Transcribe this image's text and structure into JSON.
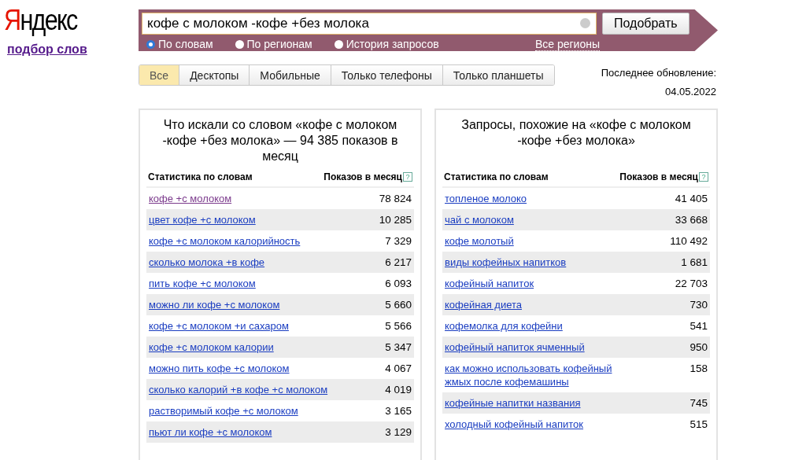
{
  "logo": {
    "text": "Яндекс",
    "subtitle": "подбор слов"
  },
  "search": {
    "value": "кофе с молоком -кофе +без молока",
    "submit": "Подобрать",
    "modes": [
      {
        "label": "По словам",
        "selected": true
      },
      {
        "label": "По регионам",
        "selected": false
      },
      {
        "label": "История запросов",
        "selected": false
      }
    ],
    "region_link": "Все регионы"
  },
  "device_tabs": [
    {
      "label": "Все",
      "selected": true
    },
    {
      "label": "Десктопы",
      "selected": false
    },
    {
      "label": "Мобильные",
      "selected": false
    },
    {
      "label": "Только телефоны",
      "selected": false
    },
    {
      "label": "Только планшеты",
      "selected": false
    }
  ],
  "last_update": {
    "label": "Последнее обновление:",
    "date": "04.05.2022"
  },
  "panels": [
    {
      "title": "Что искали со словом «кофе с молоком -кофе +без молока» — 94 385 показов в месяц",
      "columns": [
        "Статистика по словам",
        "Показов в месяц"
      ],
      "help": "?",
      "rows": [
        {
          "phrase": "кофе +с молоком",
          "count": "78 824",
          "visited": true
        },
        {
          "phrase": "цвет кофе +с молоком",
          "count": "10 285",
          "visited": false
        },
        {
          "phrase": "кофе +с молоком калорийность",
          "count": "7 329",
          "visited": false
        },
        {
          "phrase": "сколько молока +в кофе",
          "count": "6 217",
          "visited": false
        },
        {
          "phrase": "пить кофе +с молоком",
          "count": "6 093",
          "visited": false
        },
        {
          "phrase": "можно ли кофе +с молоком",
          "count": "5 660",
          "visited": false
        },
        {
          "phrase": "кофе +с молоком +и сахаром",
          "count": "5 566",
          "visited": false
        },
        {
          "phrase": "кофе +с молоком калории",
          "count": "5 347",
          "visited": false
        },
        {
          "phrase": "можно пить кофе +с молоком",
          "count": "4 067",
          "visited": false
        },
        {
          "phrase": "сколько калорий +в кофе +с молоком",
          "count": "4 019",
          "visited": false
        },
        {
          "phrase": "растворимый кофе +с молоком",
          "count": "3 165",
          "visited": false
        },
        {
          "phrase": "пьют ли кофе +с молоком",
          "count": "3 129",
          "visited": false
        }
      ]
    },
    {
      "title": "Запросы, похожие на «кофе с молоком -кофе +без молока»",
      "columns": [
        "Статистика по словам",
        "Показов в месяц"
      ],
      "help": "?",
      "rows": [
        {
          "phrase": "топленое молоко",
          "count": "41 405",
          "visited": false
        },
        {
          "phrase": "чай с молоком",
          "count": "33 668",
          "visited": false
        },
        {
          "phrase": "кофе молотый",
          "count": "110 492",
          "visited": false
        },
        {
          "phrase": "виды кофейных напитков",
          "count": "1 681",
          "visited": false
        },
        {
          "phrase": "кофейный напиток",
          "count": "22 703",
          "visited": false
        },
        {
          "phrase": "кофейная диета",
          "count": "730",
          "visited": false
        },
        {
          "phrase": "кофемолка для кофейни",
          "count": "541",
          "visited": false
        },
        {
          "phrase": "кофейный напиток ячменный",
          "count": "950",
          "visited": false
        },
        {
          "phrase": "как можно использовать кофейный жмых после кофемашины",
          "count": "158",
          "visited": false
        },
        {
          "phrase": "кофейные напитки названия",
          "count": "745",
          "visited": false
        },
        {
          "phrase": "холодный кофейный напиток",
          "count": "515",
          "visited": false
        }
      ]
    }
  ]
}
